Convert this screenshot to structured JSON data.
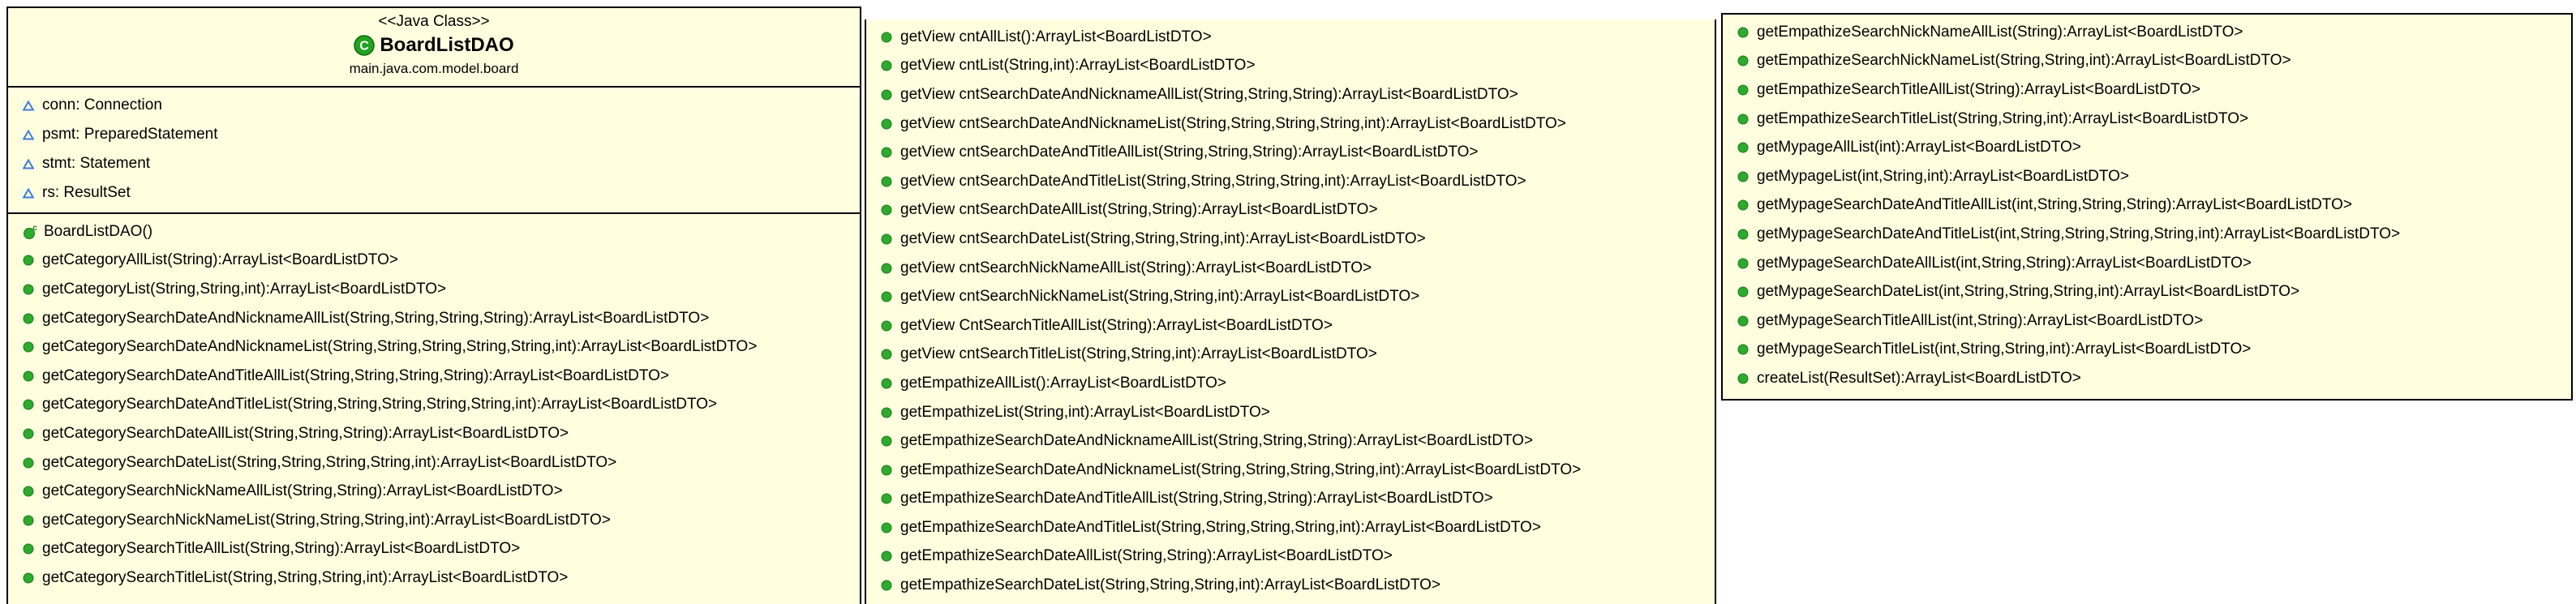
{
  "class": {
    "stereotype": "<<Java Class>>",
    "name": "BoardListDAO",
    "package": "main.java.com.model.board",
    "class_icon_letter": "C",
    "constructor_marker": "c"
  },
  "colors": {
    "background": "#ffffe0",
    "border": "#000000",
    "method_icon": "#2eaa2e",
    "field_icon": "#3d7be0",
    "class_icon": "#21a321"
  },
  "icons": {
    "field": "package-private-field-triangle-icon",
    "method": "public-method-green-dot-icon",
    "constructor": "constructor-green-dot-icon",
    "class": "java-class-c-icon"
  },
  "fields": [
    "conn: Connection",
    "psmt: PreparedStatement",
    "stmt: Statement",
    "rs: ResultSet"
  ],
  "constructor": "BoardListDAO()",
  "methods_col1": [
    "getCategoryAllList(String):ArrayList<BoardListDTO>",
    "getCategoryList(String,String,int):ArrayList<BoardListDTO>",
    "getCategorySearchDateAndNicknameAllList(String,String,String,String):ArrayList<BoardListDTO>",
    "getCategorySearchDateAndNicknameList(String,String,String,String,String,int):ArrayList<BoardListDTO>",
    "getCategorySearchDateAndTitleAllList(String,String,String,String):ArrayList<BoardListDTO>",
    "getCategorySearchDateAndTitleList(String,String,String,String,String,int):ArrayList<BoardListDTO>",
    "getCategorySearchDateAllList(String,String,String):ArrayList<BoardListDTO>",
    "getCategorySearchDateList(String,String,String,String,int):ArrayList<BoardListDTO>",
    "getCategorySearchNickNameAllList(String,String):ArrayList<BoardListDTO>",
    "getCategorySearchNickNameList(String,String,String,int):ArrayList<BoardListDTO>",
    "getCategorySearchTitleAllList(String,String):ArrayList<BoardListDTO>",
    "getCategorySearchTitleList(String,String,String,int):ArrayList<BoardListDTO>"
  ],
  "methods_col2": [
    "getView cntAllList():ArrayList<BoardListDTO>",
    "getView cntList(String,int):ArrayList<BoardListDTO>",
    "getView cntSearchDateAndNicknameAllList(String,String,String):ArrayList<BoardListDTO>",
    "getView cntSearchDateAndNicknameList(String,String,String,String,int):ArrayList<BoardListDTO>",
    "getView cntSearchDateAndTitleAllList(String,String,String):ArrayList<BoardListDTO>",
    "getView cntSearchDateAndTitleList(String,String,String,String,int):ArrayList<BoardListDTO>",
    "getView cntSearchDateAllList(String,String):ArrayList<BoardListDTO>",
    "getView cntSearchDateList(String,String,String,int):ArrayList<BoardListDTO>",
    "getView cntSearchNickNameAllList(String):ArrayList<BoardListDTO>",
    "getView cntSearchNickNameList(String,String,int):ArrayList<BoardListDTO>",
    "getView CntSearchTitleAllList(String):ArrayList<BoardListDTO>",
    "getView cntSearchTitleList(String,String,int):ArrayList<BoardListDTO>",
    "getEmpathizeAllList():ArrayList<BoardListDTO>",
    "getEmpathizeList(String,int):ArrayList<BoardListDTO>",
    "getEmpathizeSearchDateAndNicknameAllList(String,String,String):ArrayList<BoardListDTO>",
    "getEmpathizeSearchDateAndNicknameList(String,String,String,String,int):ArrayList<BoardListDTO>",
    "getEmpathizeSearchDateAndTitleAllList(String,String,String):ArrayList<BoardListDTO>",
    "getEmpathizeSearchDateAndTitleList(String,String,String,String,int):ArrayList<BoardListDTO>",
    "getEmpathizeSearchDateAllList(String,String):ArrayList<BoardListDTO>",
    "getEmpathizeSearchDateList(String,String,String,int):ArrayList<BoardListDTO>"
  ],
  "methods_col3": [
    "getEmpathizeSearchNickNameAllList(String):ArrayList<BoardListDTO>",
    "getEmpathizeSearchNickNameList(String,String,int):ArrayList<BoardListDTO>",
    "getEmpathizeSearchTitleAllList(String):ArrayList<BoardListDTO>",
    "getEmpathizeSearchTitleList(String,String,int):ArrayList<BoardListDTO>",
    "getMypageAllList(int):ArrayList<BoardListDTO>",
    "getMypageList(int,String,int):ArrayList<BoardListDTO>",
    "getMypageSearchDateAndTitleAllList(int,String,String,String):ArrayList<BoardListDTO>",
    "getMypageSearchDateAndTitleList(int,String,String,String,String,int):ArrayList<BoardListDTO>",
    "getMypageSearchDateAllList(int,String,String):ArrayList<BoardListDTO>",
    "getMypageSearchDateList(int,String,String,String,int):ArrayList<BoardListDTO>",
    "getMypageSearchTitleAllList(int,String):ArrayList<BoardListDTO>",
    "getMypageSearchTitleList(int,String,String,int):ArrayList<BoardListDTO>",
    "createList(ResultSet):ArrayList<BoardListDTO>"
  ]
}
